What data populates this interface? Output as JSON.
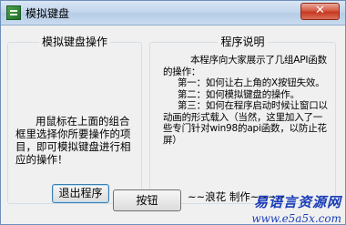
{
  "window": {
    "title": "模拟键盘",
    "close_label": "✕"
  },
  "groups": {
    "left": {
      "title": "模拟键盘操作",
      "text": "用鼠标在上面的组合框里选择你所要操作的项目，即可模拟键盘进行相应的操作！"
    },
    "right": {
      "title": "程序说明",
      "lines": [
        "本程序向大家展示了几组API函数的操作：",
        "第一：如何让右上角的X按钮失效。",
        "第二：如何模拟键盘的操作。",
        "第三：如何在程序启动时候让窗口以动画的形式载入（当然，这里加入了一些专门针对win98的api函数，以防止花屏）"
      ]
    }
  },
  "buttons": {
    "exit_label": "退出程序",
    "ok_label": "按钮"
  },
  "credit": "~~浪花 制作~~~~",
  "watermark": {
    "chinese": "易语言资源网",
    "url": "www.e5a5x.com"
  }
}
